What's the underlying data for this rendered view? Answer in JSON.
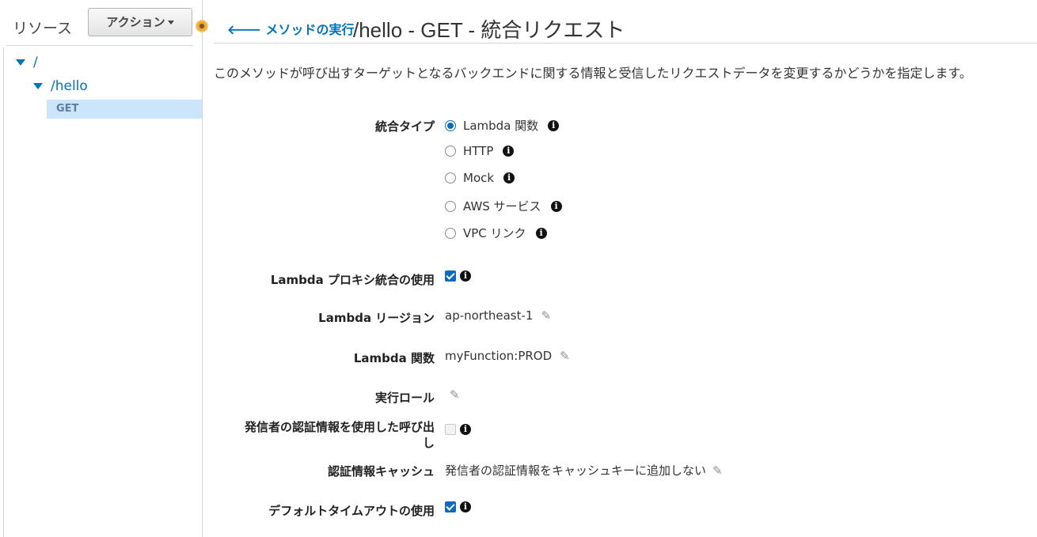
{
  "sidebar": {
    "title": "リソース",
    "action_label": "アクション",
    "tree": {
      "root": "/",
      "hello": "/hello",
      "method": "GET"
    }
  },
  "header": {
    "back_label": "メソッドの実行",
    "title": "/hello - GET - 統合リクエスト"
  },
  "description": "このメソッドが呼び出すターゲットとなるバックエンドに関する情報と受信したリクエストデータを変更するかどうかを指定します。",
  "form": {
    "integration_type": {
      "label": "統合タイプ",
      "options": [
        {
          "label": "Lambda 関数",
          "selected": true
        },
        {
          "label": "HTTP",
          "selected": false
        },
        {
          "label": "Mock",
          "selected": false
        },
        {
          "label": "AWS サービス",
          "selected": false
        },
        {
          "label": "VPC リンク",
          "selected": false
        }
      ]
    },
    "proxy": {
      "label": "Lambda プロキシ統合の使用",
      "checked": true
    },
    "region": {
      "label": "Lambda リージョン",
      "value": "ap-northeast-1"
    },
    "function": {
      "label": "Lambda 関数",
      "value": "myFunction:PROD"
    },
    "role": {
      "label": "実行ロール",
      "value": ""
    },
    "caller_credentials": {
      "label_line1": "発信者の認証情報を使用した呼び出",
      "label_line2": "し",
      "checked": false
    },
    "credentials_cache": {
      "label": "認証情報キャッシュ",
      "value": "発信者の認証情報をキャッシュキーに追加しない"
    },
    "default_timeout": {
      "label": "デフォルトタイムアウトの使用",
      "checked": true
    }
  },
  "icons": {
    "info": "i",
    "pencil": "✎",
    "back_arrow": "🡐"
  },
  "colors": {
    "link": "#0073bb",
    "selected_bg": "#cce5fa",
    "accent": "#0f6cbd"
  }
}
